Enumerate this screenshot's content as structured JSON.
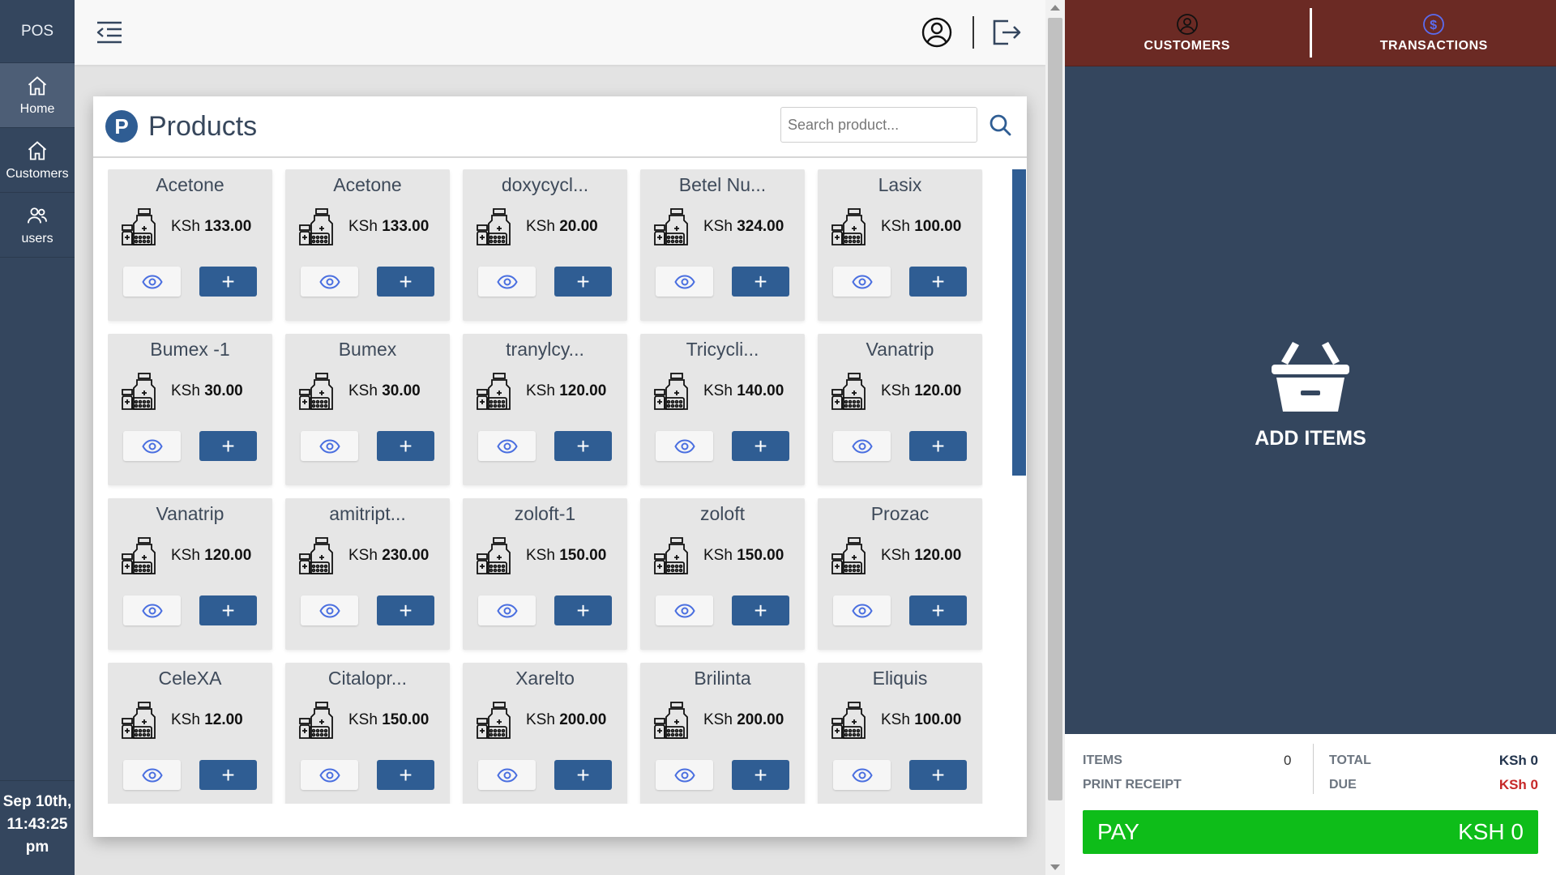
{
  "nav": {
    "brand": "POS",
    "items": [
      {
        "label": "Home",
        "icon": "home-icon",
        "active": true
      },
      {
        "label": "Customers",
        "icon": "home-icon",
        "active": false
      },
      {
        "label": "users",
        "icon": "users-icon",
        "active": false
      }
    ],
    "clock": "Sep 10th, 11:43:25 pm"
  },
  "products": {
    "title": "Products",
    "badge": "P",
    "search_placeholder": "Search product...",
    "currency": "KSh",
    "items": [
      {
        "name": "Acetone",
        "price": "133.00"
      },
      {
        "name": "Acetone",
        "price": "133.00"
      },
      {
        "name": "doxycycl...",
        "price": "20.00"
      },
      {
        "name": "Betel Nu...",
        "price": "324.00"
      },
      {
        "name": "Lasix",
        "price": "100.00"
      },
      {
        "name": "Bumex -1",
        "price": "30.00"
      },
      {
        "name": "Bumex",
        "price": "30.00"
      },
      {
        "name": "tranylcy...",
        "price": "120.00"
      },
      {
        "name": "Tricycli...",
        "price": "140.00"
      },
      {
        "name": "Vanatrip",
        "price": "120.00"
      },
      {
        "name": "Vanatrip",
        "price": "120.00"
      },
      {
        "name": "amitript...",
        "price": "230.00"
      },
      {
        "name": "zoloft-1",
        "price": "150.00"
      },
      {
        "name": "zoloft",
        "price": "150.00"
      },
      {
        "name": "Prozac",
        "price": "120.00"
      },
      {
        "name": "CeleXA",
        "price": "12.00"
      },
      {
        "name": "Citalopr...",
        "price": "150.00"
      },
      {
        "name": "Xarelto",
        "price": "200.00"
      },
      {
        "name": "Brilinta",
        "price": "200.00"
      },
      {
        "name": "Eliquis",
        "price": "100.00"
      }
    ],
    "add_label": "+"
  },
  "cart": {
    "tabs": [
      {
        "label": "CUSTOMERS",
        "icon": "user-circle-icon"
      },
      {
        "label": "TRANSACTIONS",
        "icon": "dollar-circle-icon"
      }
    ],
    "empty_label": "ADD ITEMS",
    "items_label": "ITEMS",
    "items_count": "0",
    "print_receipt_label": "PRINT RECEIPT",
    "total_label": "TOTAL",
    "total_value": "KSh 0",
    "due_label": "DUE",
    "due_value": "KSh 0",
    "pay_label": "PAY",
    "pay_amount": "KSH 0"
  },
  "colors": {
    "nav_bg": "#34465e",
    "accent_blue": "#2f5d93",
    "tabs_bg": "#6b2a24",
    "pay_green": "#0ebd19",
    "due_red": "#c62828",
    "total_navy": "#22344d"
  }
}
